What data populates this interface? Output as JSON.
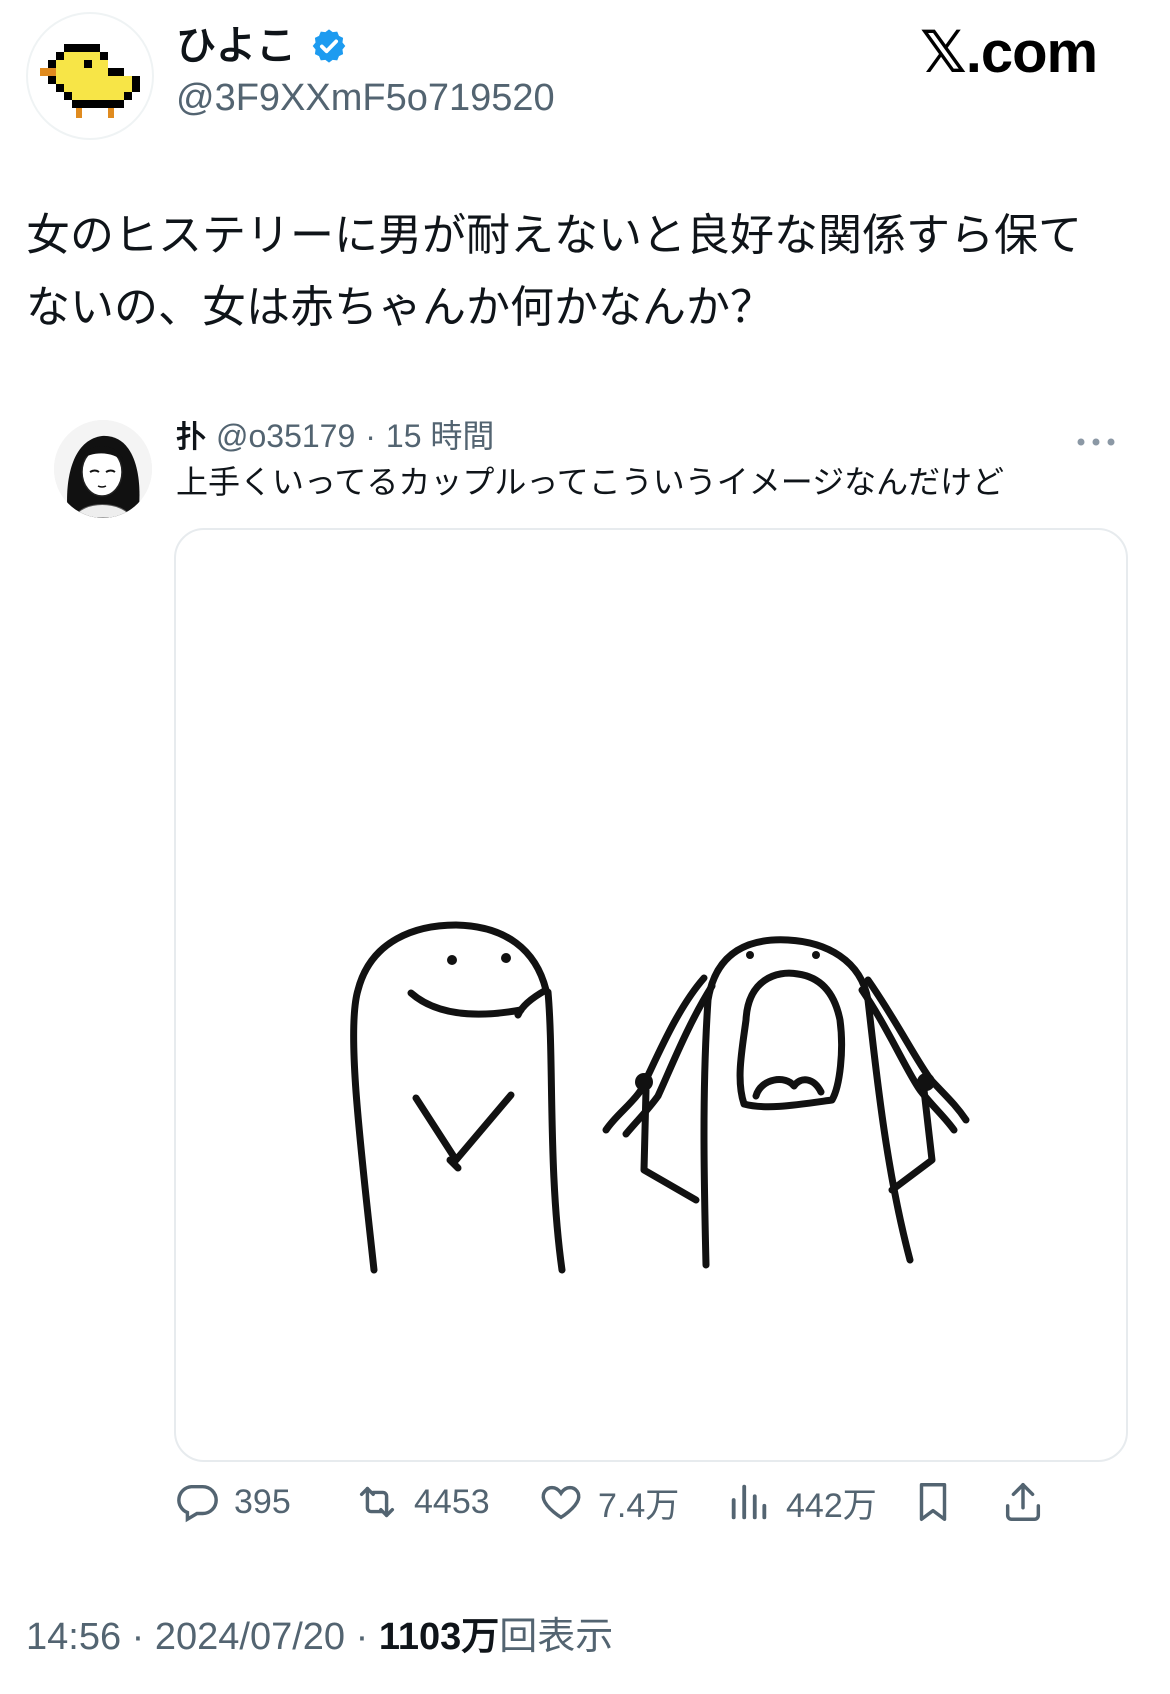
{
  "author": {
    "display_name": "ひよこ",
    "handle": "@3F9XXmF5o719520",
    "avatar": "chick-icon",
    "verified_icon": "verified-badge-icon"
  },
  "brand": {
    "x": "𝕏",
    "domain": ".com"
  },
  "tweet": {
    "line1": "女のヒステリーに男が耐えないと良好な関係すら保て",
    "line2": "ないの、女は赤ちゃんか何かなんか？"
  },
  "quoted": {
    "name": "扑",
    "handle": "@o35179",
    "sep": "·",
    "time": "15 時間",
    "text": "上手くいってるカップルってこういうイメージなんだけど",
    "more_icon": "more-dots-icon",
    "media": "couple-drawing-image"
  },
  "actions": {
    "reply_count": "395",
    "retweet_count": "4453",
    "like_count": "7.4万",
    "views_count": "442万"
  },
  "footer": {
    "time": "14:56",
    "sep1": " · ",
    "date": "2024/07/20",
    "sep2": " · ",
    "views_num": "1103万",
    "views_label": "回表示"
  },
  "colors": {
    "accent": "#1d9bf0",
    "secondary_text": "#536471",
    "chick_yellow": "#f7e547"
  }
}
